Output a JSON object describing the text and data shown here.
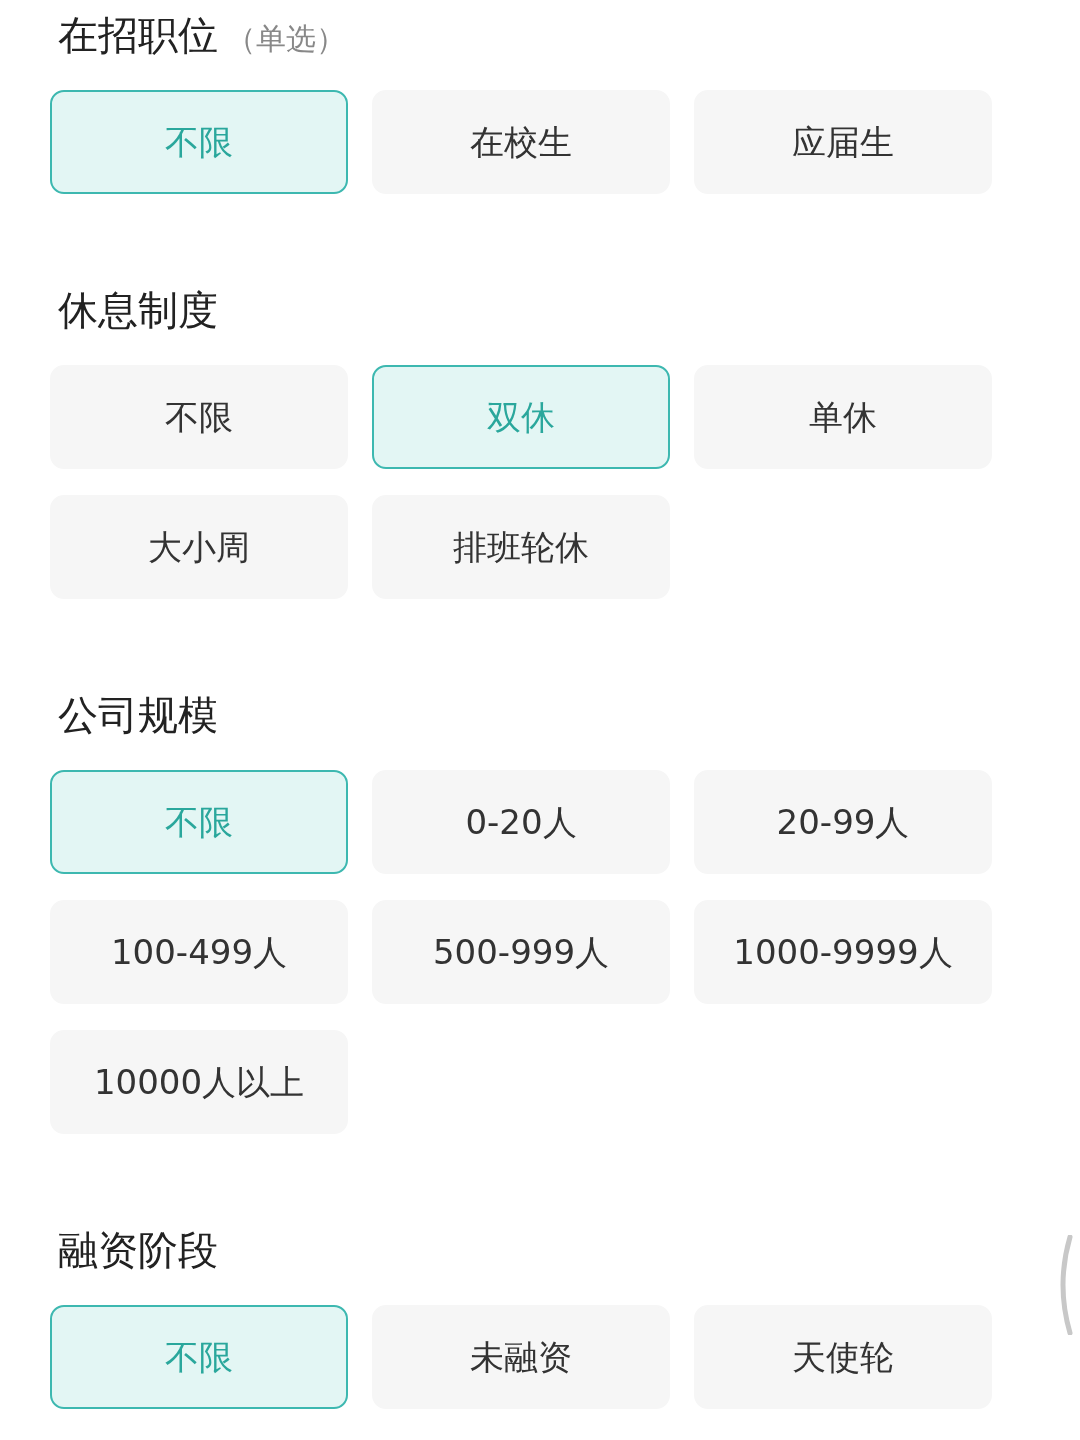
{
  "sections": [
    {
      "title": "在招职位",
      "note": "（单选）",
      "options": [
        {
          "label": "不限",
          "selected": true
        },
        {
          "label": "在校生",
          "selected": false
        },
        {
          "label": "应届生",
          "selected": false
        }
      ]
    },
    {
      "title": "休息制度",
      "options": [
        {
          "label": "不限",
          "selected": false
        },
        {
          "label": "双休",
          "selected": true
        },
        {
          "label": "单休",
          "selected": false
        },
        {
          "label": "大小周",
          "selected": false
        },
        {
          "label": "排班轮休",
          "selected": false
        }
      ]
    },
    {
      "title": "公司规模",
      "options": [
        {
          "label": "不限",
          "selected": true
        },
        {
          "label": "0-20人",
          "selected": false
        },
        {
          "label": "20-99人",
          "selected": false
        },
        {
          "label": "100-499人",
          "selected": false
        },
        {
          "label": "500-999人",
          "selected": false
        },
        {
          "label": "1000-9999人",
          "selected": false
        },
        {
          "label": "10000人以上",
          "selected": false
        }
      ]
    },
    {
      "title": "融资阶段",
      "options": [
        {
          "label": "不限",
          "selected": true
        },
        {
          "label": "未融资",
          "selected": false
        },
        {
          "label": "天使轮",
          "selected": false
        }
      ]
    }
  ]
}
